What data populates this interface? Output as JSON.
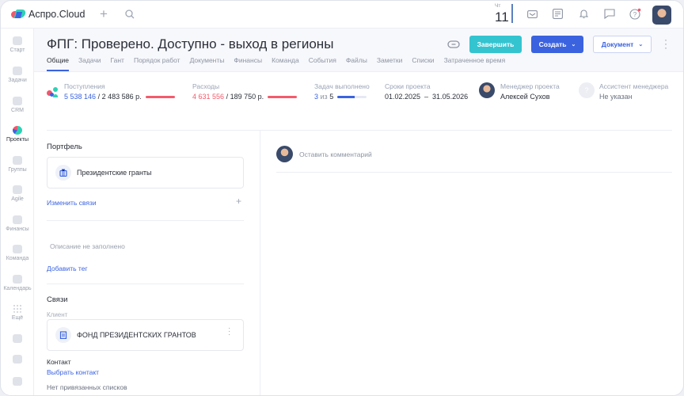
{
  "app": {
    "name": "Аспро.Cloud"
  },
  "topbar": {
    "day_name": "Чт",
    "day_number": "11"
  },
  "sidebar": {
    "items": [
      {
        "label": "Старт"
      },
      {
        "label": "Задачи"
      },
      {
        "label": "CRM"
      },
      {
        "label": "Проекты"
      },
      {
        "label": "Группы"
      },
      {
        "label": "Agile"
      },
      {
        "label": "Финансы"
      },
      {
        "label": "Команда"
      },
      {
        "label": "Календарь"
      },
      {
        "label": "Ещё"
      }
    ]
  },
  "project": {
    "title": "ФПГ: Проверено. Доступно - выход в регионы"
  },
  "actions": {
    "finish": "Завершить",
    "create": "Создать",
    "document": "Документ"
  },
  "tabs": [
    {
      "label": "Общие"
    },
    {
      "label": "Задачи"
    },
    {
      "label": "Гант"
    },
    {
      "label": "Порядок работ"
    },
    {
      "label": "Документы"
    },
    {
      "label": "Финансы"
    },
    {
      "label": "Команда"
    },
    {
      "label": "События"
    },
    {
      "label": "Файлы"
    },
    {
      "label": "Заметки"
    },
    {
      "label": "Списки"
    },
    {
      "label": "Затраченное время"
    }
  ],
  "stats": {
    "income": {
      "label": "Поступления",
      "actual": "5 538 146",
      "planned": "/ 2 483 586 р."
    },
    "expenses": {
      "label": "Расходы",
      "actual": "4 631 556",
      "planned": "/ 189 750 р."
    },
    "tasks": {
      "label": "Задач выполнено",
      "done": "3",
      "of": "из",
      "total": "5",
      "progress": 0.6
    },
    "dates": {
      "label": "Сроки проекта",
      "value": "01.02.2025  –  31.05.2026"
    },
    "manager": {
      "label": "Менеджер проекта",
      "value": "Алексей Сухов"
    },
    "assistant": {
      "label": "Ассистент менеджера",
      "value": "Не указан"
    }
  },
  "left": {
    "portfolio_title": "Портфель",
    "portfolio_item": "Президентские гранты",
    "change_links": "Изменить связи",
    "description": "Описание не заполнено",
    "add_tag": "Добавить тег",
    "links_title": "Связи",
    "client_label": "Клиент",
    "client_name": "ФОНД ПРЕЗИДЕНТСКИХ ГРАНТОВ",
    "contact_label": "Контакт",
    "choose_contact": "Выбрать контакт",
    "no_lists": "Нет привязанных списков"
  },
  "comments": {
    "placeholder": "Оставить комментарий"
  },
  "colors": {
    "accent": "#3b63e0",
    "teal": "#33c4d0",
    "red": "#f25b6b"
  }
}
